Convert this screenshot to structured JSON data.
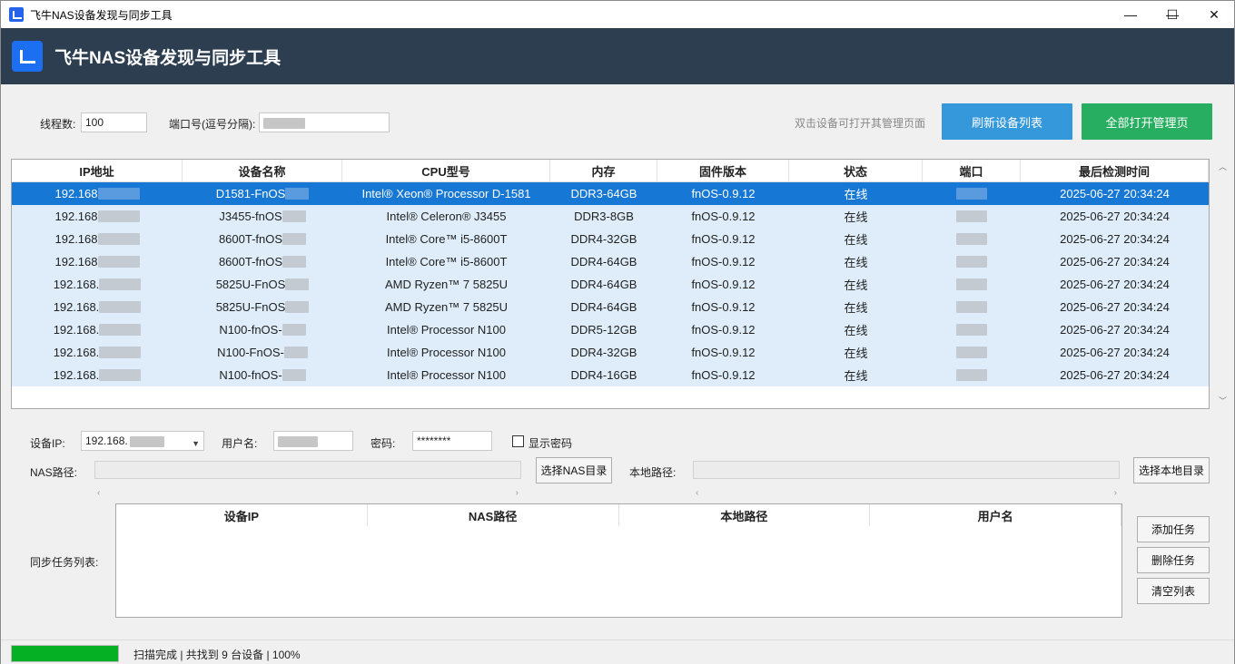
{
  "window": {
    "title": "飞牛NAS设备发现与同步工具",
    "min": "—",
    "max": "☐",
    "close": "✕"
  },
  "header": {
    "title": "飞牛NAS设备发现与同步工具"
  },
  "toolbar": {
    "threads_label": "线程数:",
    "threads_value": "100",
    "ports_label": "端口号(逗号分隔):",
    "hint": "双击设备可打开其管理页面",
    "refresh_label": "刷新设备列表",
    "open_all_label": "全部打开管理页",
    "colors": {
      "refresh": "#3498db",
      "open_all": "#27ae60",
      "header": "#2c3e50",
      "selected": "#1677d4"
    }
  },
  "device_grid": {
    "columns": [
      "IP地址",
      "设备名称",
      "CPU型号",
      "内存",
      "固件版本",
      "状态",
      "端口",
      "最后检测时间"
    ],
    "rows": [
      {
        "ip": "192.168",
        "name": "D1581-FnOS",
        "cpu": "Intel® Xeon® Processor D-1581",
        "mem": "DDR3-64GB",
        "fw": "fnOS-0.9.12",
        "status": "在线",
        "time": "2025-06-27 20:34:24",
        "selected": true
      },
      {
        "ip": "192.168",
        "name": "J3455-fnOS",
        "cpu": "Intel® Celeron® J3455",
        "mem": "DDR3-8GB",
        "fw": "fnOS-0.9.12",
        "status": "在线",
        "time": "2025-06-27 20:34:24"
      },
      {
        "ip": "192.168",
        "name": "8600T-fnOS",
        "cpu": "Intel® Core™ i5-8600T",
        "mem": "DDR4-32GB",
        "fw": "fnOS-0.9.12",
        "status": "在线",
        "time": "2025-06-27 20:34:24"
      },
      {
        "ip": "192.168",
        "name": "8600T-fnOS",
        "cpu": "Intel® Core™ i5-8600T",
        "mem": "DDR4-64GB",
        "fw": "fnOS-0.9.12",
        "status": "在线",
        "time": "2025-06-27 20:34:24"
      },
      {
        "ip": "192.168.",
        "name": "5825U-FnOS",
        "cpu": "AMD Ryzen™ 7 5825U",
        "mem": "DDR4-64GB",
        "fw": "fnOS-0.9.12",
        "status": "在线",
        "time": "2025-06-27 20:34:24"
      },
      {
        "ip": "192.168.",
        "name": "5825U-FnOS",
        "cpu": "AMD Ryzen™ 7 5825U",
        "mem": "DDR4-64GB",
        "fw": "fnOS-0.9.12",
        "status": "在线",
        "time": "2025-06-27 20:34:24"
      },
      {
        "ip": "192.168.",
        "name": "N100-fnOS-",
        "cpu": "Intel® Processor N100",
        "mem": "DDR5-12GB",
        "fw": "fnOS-0.9.12",
        "status": "在线",
        "time": "2025-06-27 20:34:24"
      },
      {
        "ip": "192.168.",
        "name": "N100-FnOS-",
        "cpu": "Intel® Processor N100",
        "mem": "DDR4-32GB",
        "fw": "fnOS-0.9.12",
        "status": "在线",
        "time": "2025-06-27 20:34:24"
      },
      {
        "ip": "192.168.",
        "name": "N100-fnOS-",
        "cpu": "Intel® Processor N100",
        "mem": "DDR4-16GB",
        "fw": "fnOS-0.9.12",
        "status": "在线",
        "time": "2025-06-27 20:34:24"
      }
    ]
  },
  "sync_form": {
    "device_ip_label": "设备IP:",
    "device_ip_value": "192.168.",
    "username_label": "用户名:",
    "password_label": "密码:",
    "password_value": "********",
    "show_password_label": "显示密码",
    "nas_path_label": "NAS路径:",
    "choose_nas_label": "选择NAS目录",
    "local_path_label": "本地路径:",
    "choose_local_label": "选择本地目录",
    "task_list_label": "同步任务列表:",
    "task_columns": [
      "设备IP",
      "NAS路径",
      "本地路径",
      "用户名"
    ],
    "add_task_label": "添加任务",
    "delete_task_label": "删除任务",
    "clear_list_label": "清空列表"
  },
  "status_bar": {
    "progress": 1.0,
    "text": "扫描完成 | 共找到 9 台设备 | 100%"
  }
}
